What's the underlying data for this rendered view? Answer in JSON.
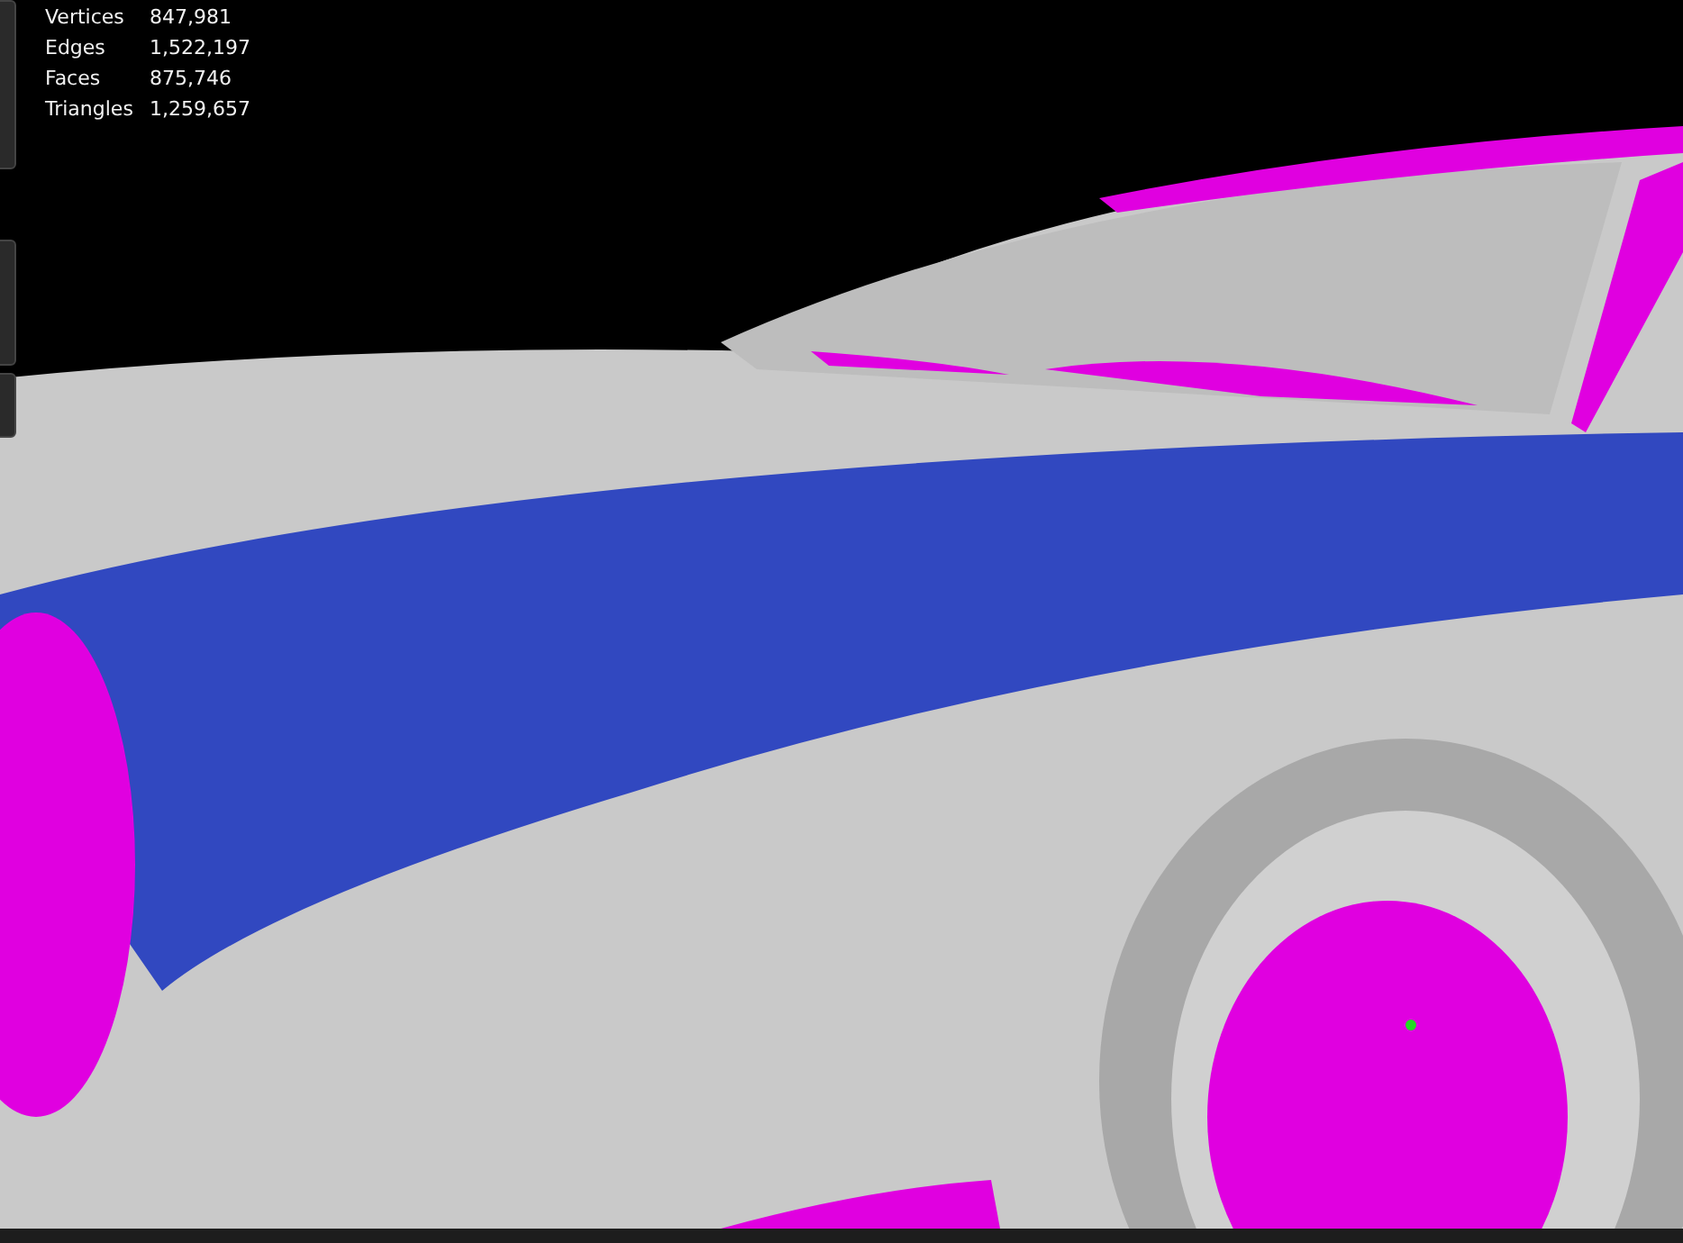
{
  "statistics": [
    {
      "label": "Vertices",
      "value": "847,981"
    },
    {
      "label": "Edges",
      "value": "1,522,197"
    },
    {
      "label": "Faces",
      "value": "875,746"
    },
    {
      "label": "Triangles",
      "value": "1,259,657"
    }
  ]
}
